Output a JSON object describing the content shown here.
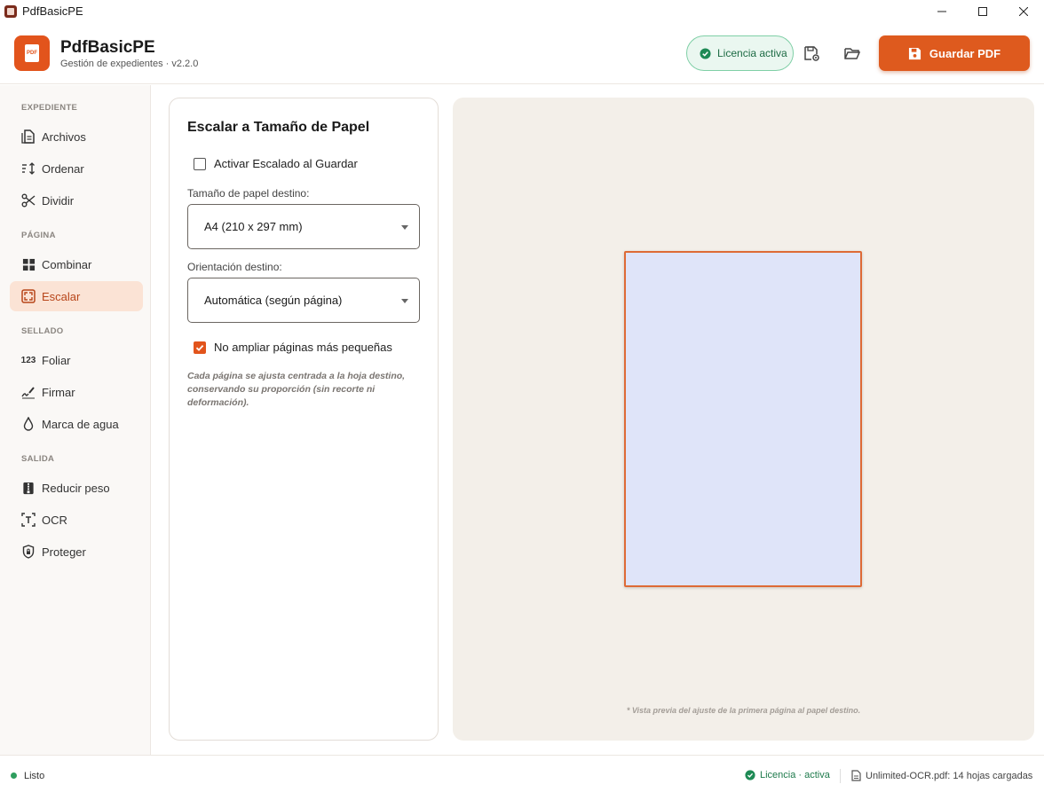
{
  "window": {
    "title": "PdfBasicPE",
    "controls": {
      "minimize_icon": "minimize-icon",
      "maximize_icon": "maximize-icon",
      "close_icon": "close-icon"
    }
  },
  "header": {
    "logo_text": "PDF",
    "app_name": "PdfBasicPE",
    "subtitle": "Gestión de expedientes · v2.2.0",
    "license_label": "Licencia activa",
    "save_label": "Guardar PDF",
    "icons": [
      "check-circle-icon",
      "save-settings-icon",
      "folder-open-icon",
      "save-icon"
    ]
  },
  "sidebar": {
    "sections": [
      {
        "title": "EXPEDIENTE",
        "items": [
          {
            "label": "Archivos",
            "icon": "file-icon"
          },
          {
            "label": "Ordenar",
            "icon": "sort-icon"
          },
          {
            "label": "Dividir",
            "icon": "scissors-icon"
          }
        ]
      },
      {
        "title": "PÁGINA",
        "items": [
          {
            "label": "Combinar",
            "icon": "grid-icon"
          },
          {
            "label": "Escalar",
            "icon": "scale-icon",
            "active": true
          }
        ]
      },
      {
        "title": "SELLADO",
        "items": [
          {
            "label": "Foliar",
            "icon": "numbers-icon"
          },
          {
            "label": "Firmar",
            "icon": "signature-icon"
          },
          {
            "label": "Marca de agua",
            "icon": "drop-icon"
          }
        ]
      },
      {
        "title": "SALIDA",
        "items": [
          {
            "label": "Reducir peso",
            "icon": "compress-icon"
          },
          {
            "label": "OCR",
            "icon": "ocr-icon"
          },
          {
            "label": "Proteger",
            "icon": "shield-icon"
          }
        ]
      }
    ]
  },
  "panel": {
    "title": "Escalar a Tamaño de Papel",
    "enable_scaling_label": "Activar Escalado al Guardar",
    "enable_scaling_checked": false,
    "paper_size_label": "Tamaño de papel destino:",
    "paper_size_value": "A4 (210 x 297 mm)",
    "orientation_label": "Orientación destino:",
    "orientation_value": "Automática (según página)",
    "no_enlarge_label": "No ampliar páginas más pequeñas",
    "no_enlarge_checked": true,
    "help_text": "Cada página se ajusta centrada a la hoja destino, conservando su proporción (sin recorte ni deformación)."
  },
  "preview": {
    "note": "* Vista previa del ajuste de la primera página al papel destino."
  },
  "statusbar": {
    "status": "Listo",
    "license": "Licencia · activa",
    "file_info": "Unlimited-OCR.pdf: 14 hojas cargadas"
  },
  "colors": {
    "accent": "#de5a1e",
    "active_bg": "#fbe3d5",
    "license_green": "#1d6b44",
    "preview_bg": "#f3efe9",
    "page_fill": "#dfe4f9"
  }
}
